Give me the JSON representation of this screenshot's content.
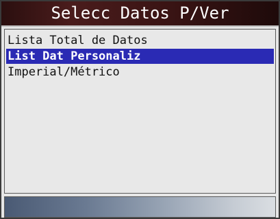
{
  "header": {
    "title": "Selecc Datos P/Ver"
  },
  "menu": {
    "items": [
      {
        "label": "Lista Total de Datos",
        "selected": false
      },
      {
        "label": "List Dat Personaliz",
        "selected": true
      },
      {
        "label": "Imperial/Métrico",
        "selected": false
      }
    ]
  },
  "colors": {
    "selection_highlight": "#2a2ab4",
    "title_background": "#3a1414",
    "screen_background": "#e6e6e6"
  }
}
